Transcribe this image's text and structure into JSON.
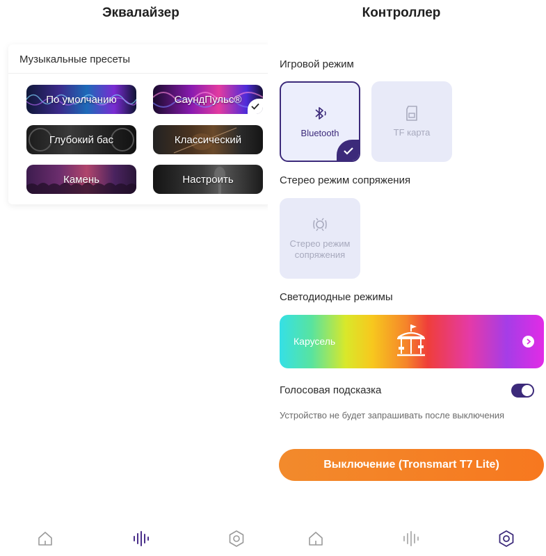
{
  "equalizer": {
    "title": "Эквалайзер",
    "presets_title": "Музыкальные пресеты",
    "presets": [
      {
        "label": "По умолчанию",
        "selected": false
      },
      {
        "label": "СаундПульс®",
        "selected": true
      },
      {
        "label": "Глубокий бас",
        "selected": false
      },
      {
        "label": "Классический",
        "selected": false
      },
      {
        "label": "Камень",
        "selected": false
      },
      {
        "label": "Настроить",
        "selected": false
      }
    ]
  },
  "controller": {
    "title": "Контроллер",
    "game_mode": {
      "label": "Игровой режим",
      "options": [
        {
          "label": "Bluetooth",
          "icon": "bluetooth-audio-icon",
          "selected": true
        },
        {
          "label": "TF карта",
          "icon": "sd-card-icon",
          "selected": false
        }
      ]
    },
    "stereo_pairing": {
      "label": "Стерео режим сопряжения",
      "tile_label": "Стерео режим сопряжения",
      "icon": "stereo-pairing-icon"
    },
    "led_modes": {
      "label": "Светодиодные режимы",
      "current": "Карусель",
      "icon": "carousel-icon"
    },
    "voice_prompt": {
      "label": "Голосовая подсказка",
      "enabled": true,
      "hint": "Устройство не будет запрашивать после выключения"
    },
    "power_off_button": "Выключение (Tronsmart T7 Lite)"
  },
  "nav": {
    "left_active": "equalizer",
    "right_active": "settings"
  },
  "colors": {
    "accent": "#3c2a7a",
    "orange": "#f7781f",
    "tile_bg": "#e8eaf8",
    "inactive_icon": "#b4b4b4"
  }
}
